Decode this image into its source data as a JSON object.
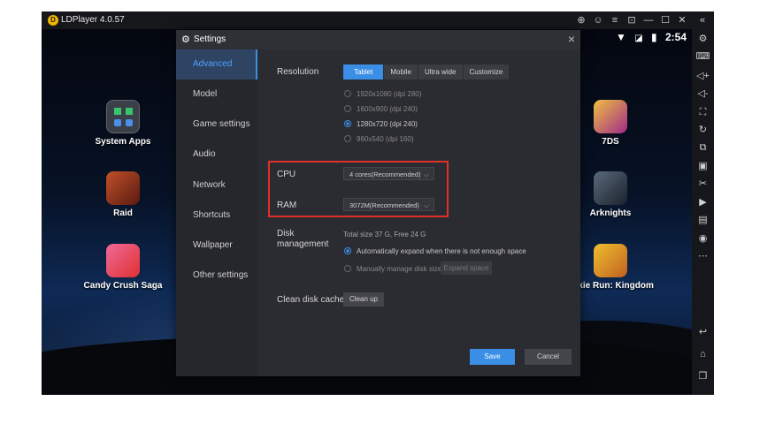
{
  "window": {
    "title": "LDPlayer 4.0.57"
  },
  "status_bar": {
    "time": "2:54"
  },
  "desktop_apps": [
    {
      "label": "System Apps",
      "color": "#3a3f4a"
    },
    {
      "label": "Raid",
      "color": "#8a2a1a"
    },
    {
      "label": "Candy Crush Saga",
      "color": "#e8457a"
    },
    {
      "label": "7DS",
      "color": "#c84a9a"
    },
    {
      "label": "Arknights",
      "color": "#2d3a4a"
    },
    {
      "label": "ookie Run: Kingdom",
      "color": "#e8a020"
    }
  ],
  "dialog": {
    "title": "Settings",
    "nav": [
      {
        "label": "Advanced",
        "active": true
      },
      {
        "label": "Model",
        "active": false
      },
      {
        "label": "Game settings",
        "active": false
      },
      {
        "label": "Audio",
        "active": false
      },
      {
        "label": "Network",
        "active": false
      },
      {
        "label": "Shortcuts",
        "active": false
      },
      {
        "label": "Wallpaper",
        "active": false
      },
      {
        "label": "Other settings",
        "active": false
      }
    ],
    "resolution": {
      "label": "Resolution",
      "tabs": [
        {
          "label": "Tablet",
          "active": true
        },
        {
          "label": "Mobile",
          "active": false
        },
        {
          "label": "Ultra wide",
          "active": false
        },
        {
          "label": "Customize",
          "active": false
        }
      ],
      "options": [
        {
          "label": "1920x1080  (dpi 280)",
          "selected": false
        },
        {
          "label": "1600x900  (dpi 240)",
          "selected": false
        },
        {
          "label": "1280x720  (dpi 240)",
          "selected": true
        },
        {
          "label": "960x540  (dpi 160)",
          "selected": false
        }
      ]
    },
    "cpu": {
      "label": "CPU",
      "value": "4 cores(Recommended)"
    },
    "ram": {
      "label": "RAM",
      "value": "3072M(Recommended)"
    },
    "disk": {
      "label_line1": "Disk",
      "label_line2": "management",
      "info": "Total size 37 G,  Free 24 G",
      "option_auto": "Automatically expand when there is not enough space",
      "option_manual": "Manually manage disk size",
      "expand_button": "Expand space"
    },
    "cache": {
      "label": "Clean disk cache",
      "button": "Clean up"
    },
    "save_button": "Save",
    "cancel_button": "Cancel"
  },
  "colors": {
    "accent": "#3a8ee6",
    "highlight_box": "#e0302a"
  }
}
